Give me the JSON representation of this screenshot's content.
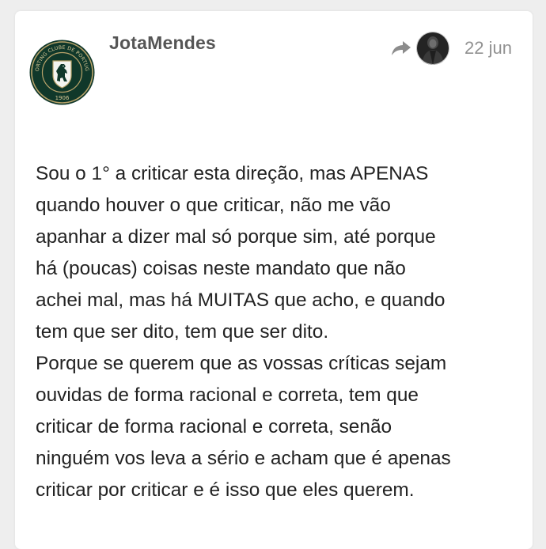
{
  "post": {
    "author": "JotaMendes",
    "date": "22 jun",
    "author_avatar": {
      "icon": "sporting-clube-de-portugal-crest",
      "ring_text": "SPORTING CLUBE DE PORTUGAL",
      "year": "1906",
      "colors": {
        "green": "#10382a",
        "gold": "#b9a36a"
      }
    },
    "reply_to": {
      "icon": "reply-arrow-icon",
      "avatar": "dark-figure-avatar"
    },
    "body_lines": [
      "Sou o 1° a criticar esta direção, mas APENAS",
      "quando houver o que criticar, não me vão",
      "apanhar a dizer mal só porque sim, até porque",
      "há (poucas) coisas neste mandato que não",
      "achei mal, mas há MUITAS que acho, e quando",
      "tem que ser dito, tem que ser dito.",
      "Porque se querem que as vossas críticas sejam",
      "ouvidas de forma racional e correta, tem que",
      "criticar de forma racional e correta, senão",
      "ninguém vos leva a sério e acham que é apenas",
      "criticar por criticar e é isso que eles querem."
    ]
  },
  "colors": {
    "background": "#eeeeee",
    "card": "#ffffff",
    "username": "#555555",
    "date": "#919191",
    "body_text": "#222222"
  }
}
